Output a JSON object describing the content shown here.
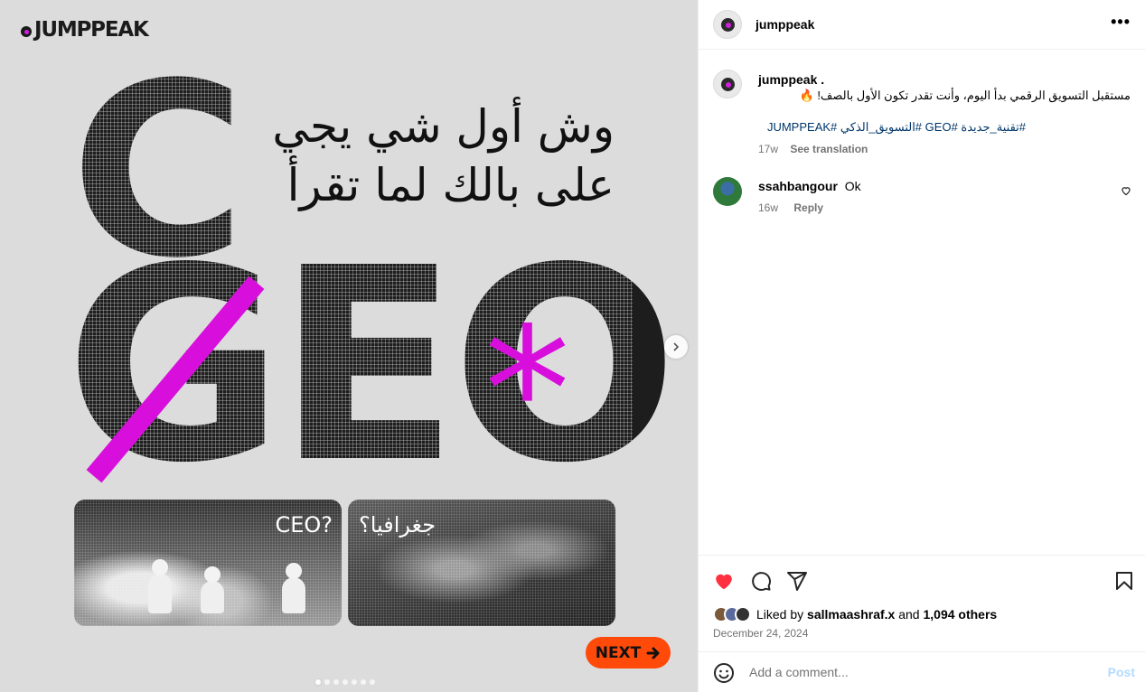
{
  "media": {
    "brand": "JUMPPEAK",
    "big_c": "C",
    "big_geo": "GEO",
    "asterisk": "*",
    "headline_line1": "وش أول شي يجي",
    "headline_line2": "على بالك لما تقرأ",
    "card_left_label": "CEO?",
    "card_right_label": "جغرافيا؟",
    "next_label": "NEXT",
    "carousel_dots": 7,
    "carousel_active": 0,
    "accent_color": "#d80fdc",
    "next_color": "#ff4a0a"
  },
  "header": {
    "username": "jumppeak"
  },
  "caption": {
    "username": "jumppeak .",
    "text": "مستقبل التسويق الرقمي بدأ اليوم، وأنت تقدر تكون الأول بالصف!",
    "emoji": "🔥",
    "hashtags": "#تقنية_جديدة #GEO #التسويق_الذكي #JUMPPEAK",
    "age": "17w",
    "see_translation": "See translation"
  },
  "comments": [
    {
      "username": "ssahbangour",
      "text": "Ok",
      "age": "16w",
      "reply_label": "Reply"
    }
  ],
  "likes": {
    "prefix": "Liked by",
    "first_user": "sallmaashraf.x",
    "and": "and",
    "others": "1,094 others"
  },
  "date": "December 24, 2024",
  "add_comment": {
    "placeholder": "Add a comment...",
    "post_label": "Post"
  }
}
